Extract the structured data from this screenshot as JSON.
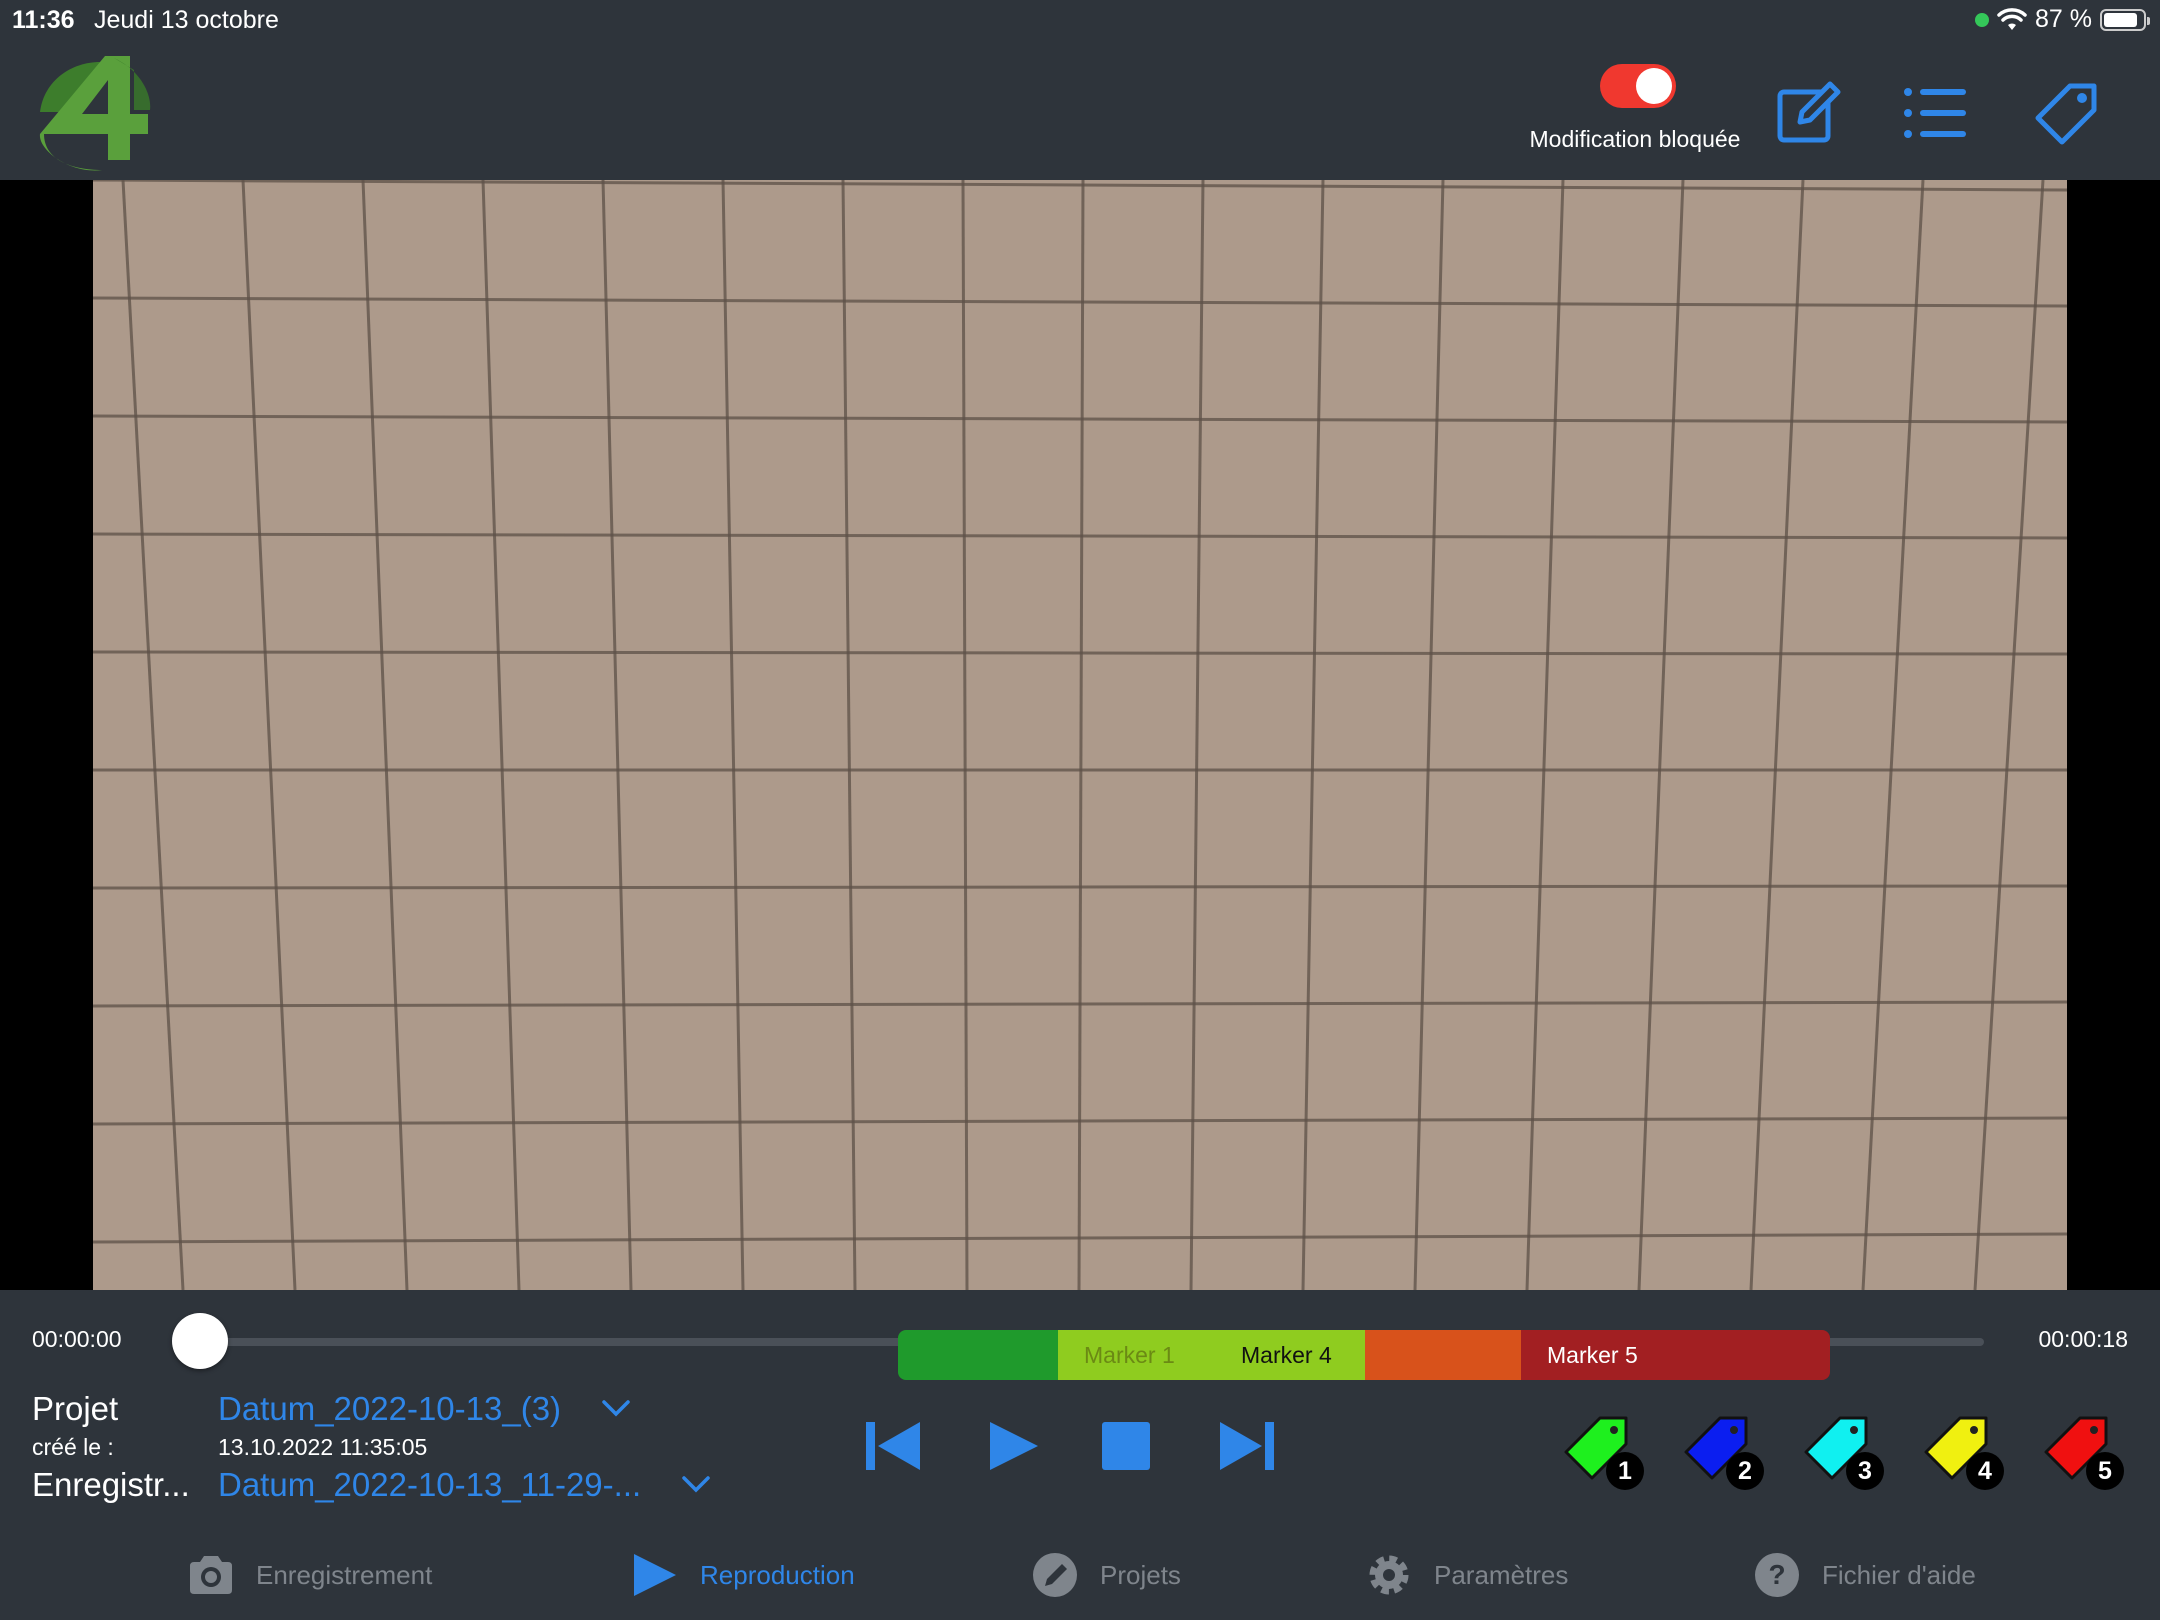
{
  "status": {
    "time": "11:36",
    "date": "Jeudi 13 octobre",
    "battery": "87 %",
    "battery_fraction": 0.87
  },
  "header": {
    "lock_label": "Modification bloquée",
    "lock_enabled": true,
    "icons": [
      "edit-icon",
      "list-icon",
      "tag-icon"
    ]
  },
  "player": {
    "time_current": "00:00:00",
    "time_total": "00:00:18",
    "position_fraction": 0.0,
    "markers": [
      {
        "label": "",
        "color": "#1f9a2c"
      },
      {
        "label": "Marker 1",
        "color": "#8fcc1f",
        "text_color": "#6b8a14"
      },
      {
        "label": "Marker 4",
        "color": "#8fcc1f",
        "text_color": "#111111"
      },
      {
        "label": "",
        "color": "#d8521b"
      },
      {
        "label": "Marker 5",
        "color": "#a21f22",
        "text_color": "#ffffff"
      }
    ]
  },
  "info": {
    "project_label": "Projet",
    "project_value": "Datum_2022-10-13_(3)",
    "created_label": "créé le :",
    "created_value": "13.10.2022 11:35:05",
    "recording_label": "Enregistr...",
    "recording_value": "Datum_2022-10-13_11-29-..."
  },
  "transport": [
    "skip-back-icon",
    "play-icon",
    "stop-icon",
    "skip-forward-icon"
  ],
  "tags": [
    {
      "number": "1",
      "color": "#1ef01e"
    },
    {
      "number": "2",
      "color": "#0b1ef0"
    },
    {
      "number": "3",
      "color": "#10f0f0"
    },
    {
      "number": "4",
      "color": "#f0f010"
    },
    {
      "number": "5",
      "color": "#f01010"
    }
  ],
  "tabs": [
    {
      "label": "Enregistrement",
      "icon": "camera-icon",
      "active": false
    },
    {
      "label": "Reproduction",
      "icon": "play-icon",
      "active": true
    },
    {
      "label": "Projets",
      "icon": "pencil-icon",
      "active": false
    },
    {
      "label": "Paramètres",
      "icon": "gear-icon",
      "active": false
    },
    {
      "label": "Fichier d'aide",
      "icon": "help-icon",
      "active": false
    }
  ],
  "colors": {
    "accent": "#2f86e8",
    "background": "#2e343b",
    "inactive": "#7f858c"
  }
}
